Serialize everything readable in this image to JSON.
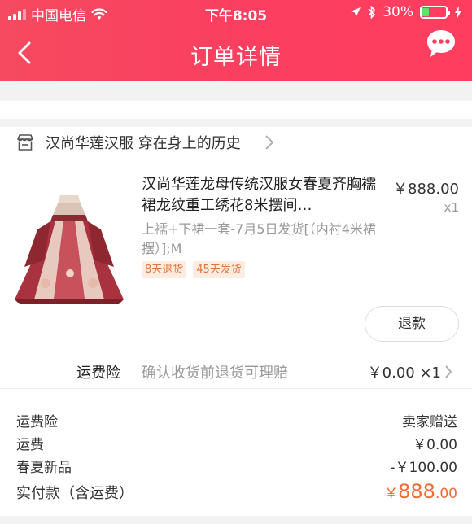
{
  "status_bar": {
    "carrier": "中国电信",
    "time": "下午8:05",
    "battery": "30%",
    "battery_level": 0.3
  },
  "nav": {
    "title": "订单详情",
    "back_icon": "chevron-left-icon",
    "chat_icon": "chat-bubble-icon"
  },
  "shop": {
    "name": "汉尚华莲汉服 穿在身上的历史",
    "icon": "store-icon"
  },
  "product": {
    "title": "汉尚华莲龙母传统汉服女春夏齐胸襦裙龙纹重工绣花8米摆间…",
    "sku": "上襦+下裙一套-7月5日发货[（内衬4米裙摆）];M",
    "price": "￥888.00",
    "qty": "x1",
    "tags": [
      "8天退货",
      "45天发货"
    ],
    "refund_label": "退款"
  },
  "insurance": {
    "label": "运费险",
    "desc": "确认收货前退货可理赔",
    "value": "￥0.00 ×1"
  },
  "summary": {
    "rows": [
      {
        "label": "运费险",
        "value": "卖家赠送"
      },
      {
        "label": "运费",
        "value": "￥0.00"
      },
      {
        "label": "春夏新品",
        "value": "-￥100.00"
      }
    ],
    "total_label": "实付款（含运费）",
    "total_currency": "￥",
    "total_int": "888",
    "total_dec": ".00"
  },
  "colors": {
    "header": "#fb3f60",
    "accent": "#f26a34",
    "tag_bg": "#fdece1"
  }
}
